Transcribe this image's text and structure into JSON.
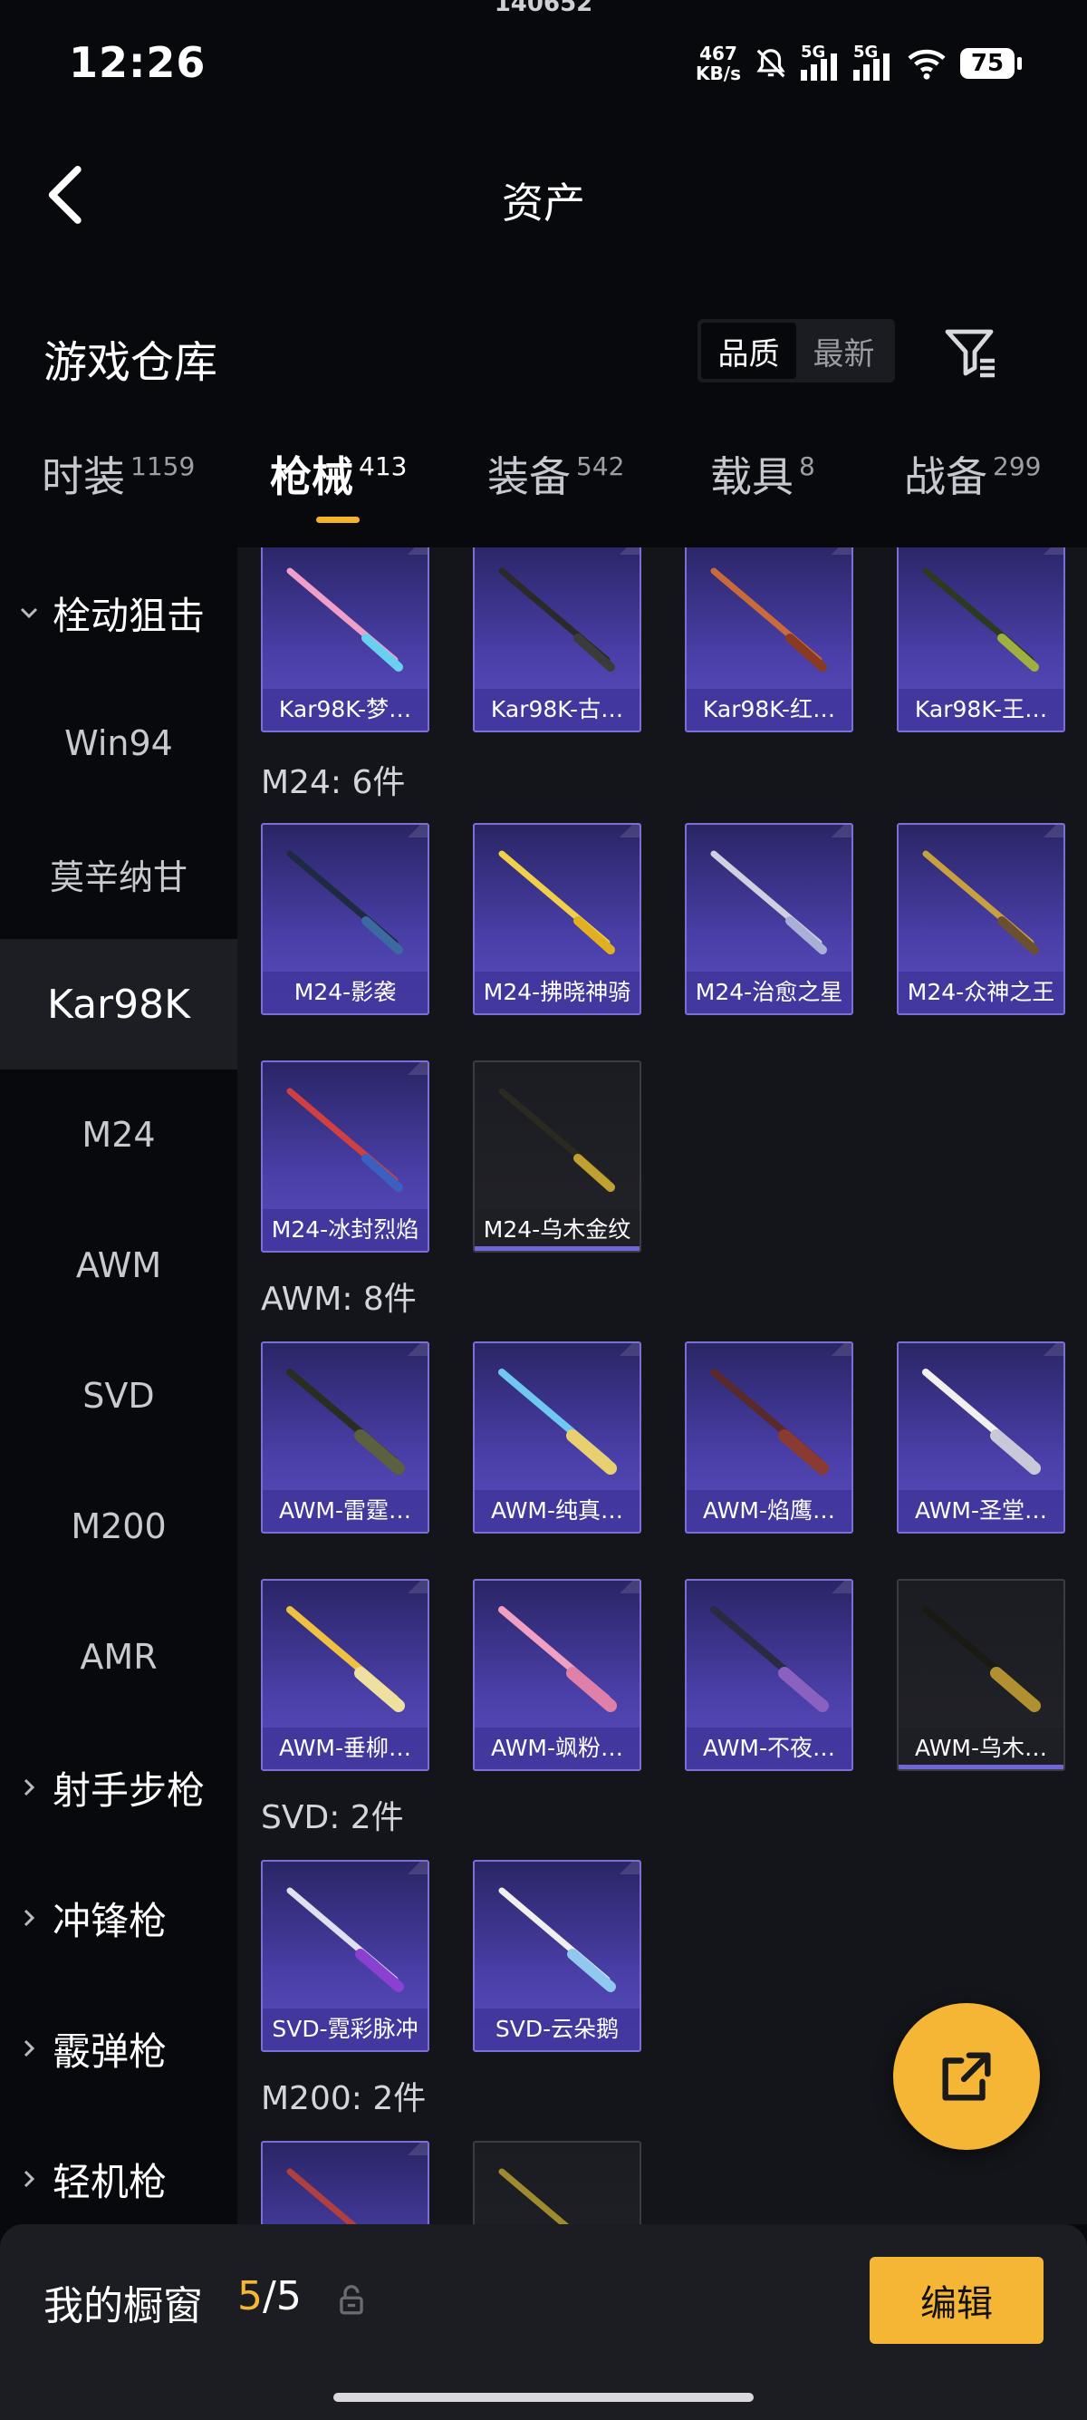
{
  "status_bar": {
    "top_text": "140652",
    "time": "12:26",
    "net_speed_value": "467",
    "net_speed_unit": "KB/s",
    "signal_1": "5G",
    "signal_2": "5G",
    "battery": "75"
  },
  "header": {
    "title": "资产"
  },
  "warehouse": {
    "title": "游戏仓库",
    "sort_options": [
      "品质",
      "最新"
    ],
    "active_sort": "品质"
  },
  "tabs": [
    {
      "label": "时装",
      "count": "1159"
    },
    {
      "label": "枪械",
      "count": "413",
      "active": true
    },
    {
      "label": "装备",
      "count": "542"
    },
    {
      "label": "载具",
      "count": "8"
    },
    {
      "label": "战备",
      "count": "299"
    }
  ],
  "sidebar": {
    "items": [
      {
        "label": "栓动狙击",
        "type": "category",
        "expanded": true
      },
      {
        "label": "Win94"
      },
      {
        "label": "莫辛纳甘"
      },
      {
        "label": "Kar98K",
        "selected": true
      },
      {
        "label": "M24"
      },
      {
        "label": "AWM"
      },
      {
        "label": "SVD"
      },
      {
        "label": "M200"
      },
      {
        "label": "AMR"
      },
      {
        "label": "射手步枪",
        "type": "category"
      },
      {
        "label": "冲锋枪",
        "type": "category"
      },
      {
        "label": "霰弹枪",
        "type": "category"
      },
      {
        "label": "轻机枪",
        "type": "category"
      }
    ]
  },
  "sections": {
    "kar98k_items": [
      "Kar98K-梦…",
      "Kar98K-古…",
      "Kar98K-红…",
      "Kar98K-王…"
    ],
    "m24": {
      "label": "M24: 6件",
      "items": [
        "M24-影袭",
        "M24-拂晓神骑",
        "M24-治愈之星",
        "M24-众神之王",
        "M24-冰封烈焰",
        "M24-乌木金纹"
      ]
    },
    "awm": {
      "label": "AWM: 8件",
      "items": [
        "AWM-雷霆…",
        "AWM-纯真…",
        "AWM-焰鹰…",
        "AWM-圣堂…",
        "AWM-垂柳…",
        "AWM-飒粉…",
        "AWM-不夜…",
        "AWM-乌木…"
      ]
    },
    "svd": {
      "label": "SVD: 2件",
      "items": [
        "SVD-霓彩脉冲",
        "SVD-云朵鹅"
      ]
    },
    "m200": {
      "label": "M200: 2件"
    }
  },
  "showcase": {
    "title": "我的橱窗",
    "current": "5",
    "separator": "/",
    "total": "5",
    "edit_label": "编辑"
  },
  "colors": {
    "accent": "#f5b535",
    "card_purple": "#4a3fa8",
    "background": "#08090d"
  }
}
